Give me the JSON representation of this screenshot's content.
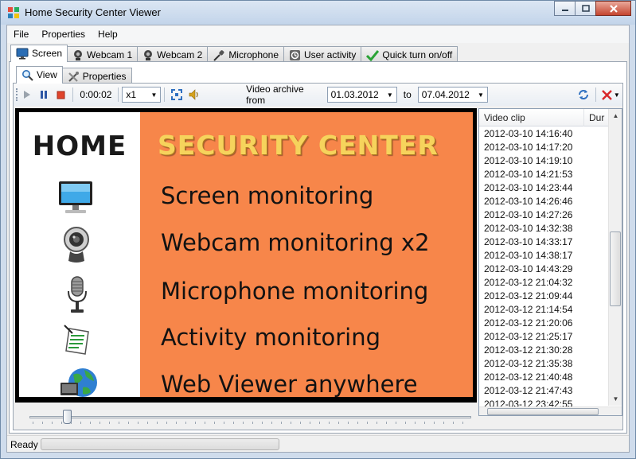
{
  "window": {
    "title": "Home Security Center Viewer"
  },
  "menu": {
    "items": [
      "File",
      "Properties",
      "Help"
    ]
  },
  "tabs": [
    {
      "label": "Screen",
      "icon": "monitor-icon"
    },
    {
      "label": "Webcam 1",
      "icon": "webcam-icon"
    },
    {
      "label": "Webcam 2",
      "icon": "webcam-icon"
    },
    {
      "label": "Microphone",
      "icon": "microphone-icon"
    },
    {
      "label": "User activity",
      "icon": "activity-icon"
    },
    {
      "label": "Quick turn on/off",
      "icon": "checkmark-icon"
    }
  ],
  "subtabs": [
    {
      "label": "View",
      "icon": "magnifier-icon"
    },
    {
      "label": "Properties",
      "icon": "tools-icon"
    }
  ],
  "toolbar": {
    "time": "0:00:02",
    "speed": "x1",
    "archive_label": "Video archive from",
    "from_date": "01.03.2012",
    "to_label": "to",
    "to_date": "07.04.2012"
  },
  "video": {
    "home": "HOME",
    "title": "SECURITY CENTER",
    "features": [
      "Screen monitoring",
      "Webcam monitoring x2",
      "Microphone monitoring",
      "Activity monitoring",
      "Web Viewer anywhere"
    ]
  },
  "clips": {
    "headers": [
      "Video clip",
      "Dur"
    ],
    "rows": [
      "2012-03-10 14:16:40",
      "2012-03-10 14:17:20",
      "2012-03-10 14:19:10",
      "2012-03-10 14:21:53",
      "2012-03-10 14:23:44",
      "2012-03-10 14:26:46",
      "2012-03-10 14:27:26",
      "2012-03-10 14:32:38",
      "2012-03-10 14:33:17",
      "2012-03-10 14:38:17",
      "2012-03-10 14:43:29",
      "2012-03-12 21:04:32",
      "2012-03-12 21:09:44",
      "2012-03-12 21:14:54",
      "2012-03-12 21:20:06",
      "2012-03-12 21:25:17",
      "2012-03-12 21:30:28",
      "2012-03-12 21:35:38",
      "2012-03-12 21:40:48",
      "2012-03-12 21:47:43",
      "2012-03-12 23:42:55"
    ]
  },
  "status": {
    "text": "Ready",
    "progress": 0
  },
  "colors": {
    "accent_orange": "#f7864a",
    "title_gold": "#f6d35c",
    "close_red": "#c5452f"
  }
}
